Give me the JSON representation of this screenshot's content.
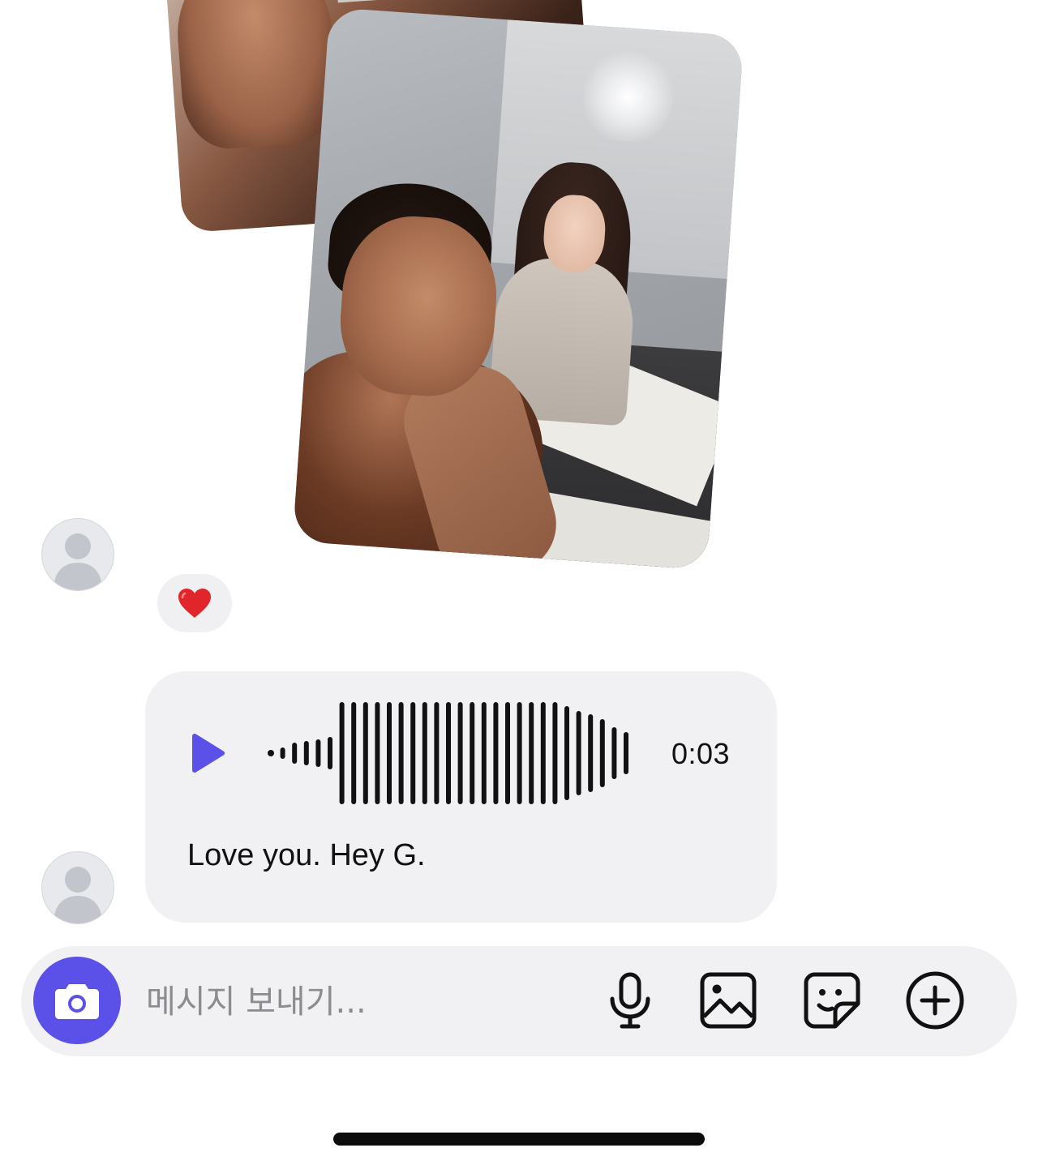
{
  "conversation": {
    "reaction_emoji": "❤️",
    "voice_message": {
      "duration": "0:03",
      "transcript": "Love you. Hey G.",
      "accent_color": "#5b50e8"
    }
  },
  "composer": {
    "placeholder": "메시지 보내기...",
    "icons": [
      "camera-icon",
      "microphone-icon",
      "gallery-icon",
      "sticker-icon",
      "plus-circle-icon"
    ],
    "accent_color": "#5b50e8"
  }
}
